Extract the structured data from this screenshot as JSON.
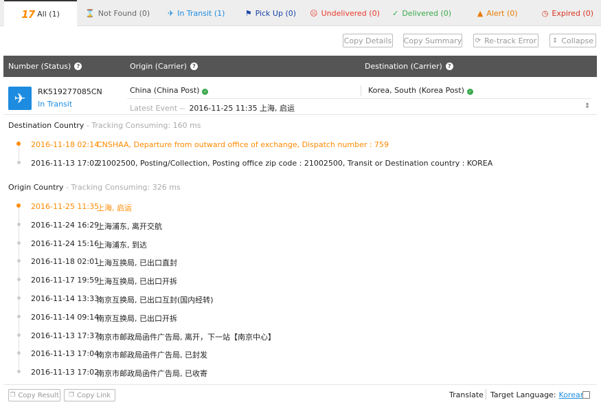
{
  "tabs": [
    {
      "icon": "17",
      "label": "All",
      "count": "(1)"
    },
    {
      "icon": "⌛",
      "label": "Not Found",
      "count": "(0)"
    },
    {
      "icon": "✈",
      "label": "In Transit",
      "count": "(1)"
    },
    {
      "icon": "⚑",
      "label": "Pick Up",
      "count": "(0)"
    },
    {
      "icon": "☹",
      "label": "Undelivered",
      "count": "(0)"
    },
    {
      "icon": "✓",
      "label": "Delivered",
      "count": "(0)"
    },
    {
      "icon": "▲",
      "label": "Alert",
      "count": "(0)"
    },
    {
      "icon": "◷",
      "label": "Expired",
      "count": "(0)"
    }
  ],
  "actions": {
    "copy_details": "Copy Details",
    "copy_summary": "Copy Summary",
    "retrack": "Re-track Error",
    "collapse": "Collapse"
  },
  "table_header": {
    "number": "Number (Status)",
    "origin": "Origin (Carrier)",
    "destination": "Destination (Carrier)"
  },
  "package": {
    "number": "RK519277085CN",
    "status": "In Transit",
    "origin": "China (China Post)",
    "destination": "Korea, South (Korea Post)",
    "latest_label": "Latest Event --",
    "latest_event": "2016-11-25 11:35 上海, 启运"
  },
  "destination_section": {
    "title": "Destination Country",
    "consuming": " - Tracking Consuming: 160 ms",
    "events": [
      {
        "time": "2016-11-18 02:14",
        "desc": "CNSHAA, Departure from outward office of exchange, Dispatch number : 759"
      },
      {
        "time": "2016-11-13 17:02",
        "desc": "21002500, Posting/Collection, Posting office zip code : 21002500, Transit or Destination country : KOREA"
      }
    ]
  },
  "origin_section": {
    "title": "Origin Country",
    "consuming": " - Tracking Consuming: 326 ms",
    "events": [
      {
        "time": "2016-11-25 11:35",
        "desc": "上海, 启运"
      },
      {
        "time": "2016-11-24 16:29",
        "desc": "上海浦东, 离开交航"
      },
      {
        "time": "2016-11-24 15:16",
        "desc": "上海浦东, 到达"
      },
      {
        "time": "2016-11-18 02:01",
        "desc": "上海互换局, 已出口直封"
      },
      {
        "time": "2016-11-17 19:59",
        "desc": "上海互换局, 已出口开拆"
      },
      {
        "time": "2016-11-14 13:33",
        "desc": "南京互换局, 已出口互封(国内经转)"
      },
      {
        "time": "2016-11-14 09:14",
        "desc": "南京互换局, 已出口开拆"
      },
      {
        "time": "2016-11-13 17:37",
        "desc": "南京市邮政局函件广告局, 离开，下一站【南京中心】"
      },
      {
        "time": "2016-11-13 17:04",
        "desc": "南京市邮政局函件广告局, 已封发"
      },
      {
        "time": "2016-11-13 17:02",
        "desc": "南京市邮政局函件广告局, 已收寄"
      }
    ]
  },
  "footer": {
    "copy_result": "Copy Result",
    "copy_link": "Copy Link",
    "translate": "Translate",
    "target_label": "Target Language:",
    "target_lang": "Korean"
  },
  "colors": {
    "accent": "#1d8ce0",
    "highlight": "#ff8a00",
    "header_bg": "#555555",
    "ok_green": "#3aa84b"
  }
}
